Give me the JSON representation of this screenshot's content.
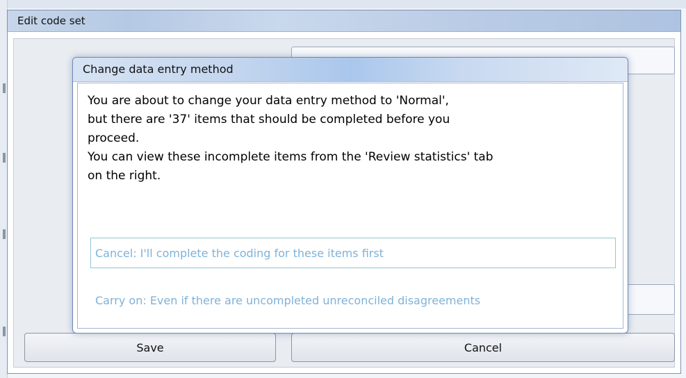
{
  "outer_dialog": {
    "title": "Edit code set",
    "save_label": "Save",
    "cancel_label": "Cancel"
  },
  "modal": {
    "title": "Change data entry method",
    "message_lines": [
      "You are about to change your data entry method to 'Normal',",
      "but there are '37' items that should be completed before you",
      "proceed.",
      "You can view these incomplete items from the 'Review statistics' tab",
      "on the right."
    ],
    "option_cancel": "Cancel: I'll complete the coding for these items first",
    "option_carry_on": "Carry on: Even if there are uncompleted unreconciled disagreements"
  },
  "colors": {
    "option_text": "#7fb2d8",
    "modal_border": "#6b88b8",
    "title_gradient": "#a9c7ec"
  }
}
